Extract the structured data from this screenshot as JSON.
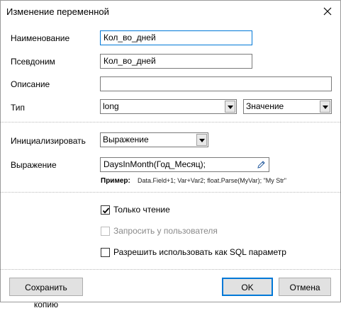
{
  "window": {
    "title": "Изменение переменной"
  },
  "fields": {
    "name": {
      "label": "Наименование",
      "value": "Кол_во_дней"
    },
    "alias": {
      "label": "Псевдоним",
      "value": "Кол_во_дней"
    },
    "description": {
      "label": "Описание",
      "value": ""
    },
    "type": {
      "label": "Тип",
      "value": "long",
      "kind_value": "Значение"
    }
  },
  "init": {
    "label": "Инициализировать",
    "value": "Выражение"
  },
  "expression": {
    "label": "Выражение",
    "value": "DaysInMonth(Год_Месяц);",
    "example_label": "Пример:",
    "example_text": "Data.Field+1; Var+Var2; float.Parse(MyVar); \"My Str\""
  },
  "options": {
    "readonly": {
      "label": "Только чтение",
      "checked": true,
      "enabled": true
    },
    "ask_user": {
      "label": "Запросить у пользователя",
      "checked": false,
      "enabled": false
    },
    "sql_param": {
      "label": "Разрешить использовать как SQL параметр",
      "checked": false,
      "enabled": true
    }
  },
  "buttons": {
    "save_copy": "Сохранить копию",
    "ok": "OK",
    "cancel": "Отмена"
  },
  "colors": {
    "accent": "#0078d7"
  }
}
